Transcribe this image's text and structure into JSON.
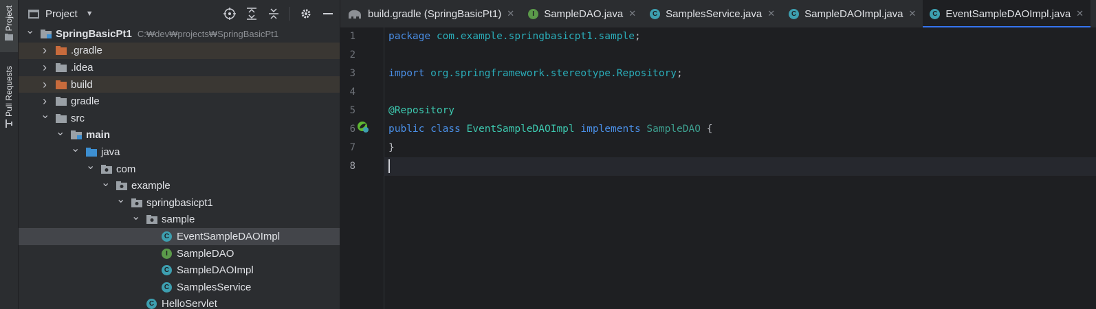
{
  "sidebar": {
    "project_tab": "Project",
    "pull_requests_tab": "Pull Requests"
  },
  "project_panel": {
    "title": "Project",
    "tree": [
      {
        "label": "SpringBasicPt1",
        "path": "C:₩dev₩projects₩SpringBasicPt1",
        "depth": 0,
        "expanded": true,
        "icon": "module-folder-icon",
        "bold": true
      },
      {
        "label": ".gradle",
        "depth": 1,
        "expanded": false,
        "icon": "excluded-folder-icon",
        "excluded": true
      },
      {
        "label": ".idea",
        "depth": 1,
        "expanded": false,
        "icon": "folder-icon"
      },
      {
        "label": "build",
        "depth": 1,
        "expanded": false,
        "icon": "excluded-folder-icon",
        "excluded": true
      },
      {
        "label": "gradle",
        "depth": 1,
        "expanded": false,
        "icon": "folder-icon"
      },
      {
        "label": "src",
        "depth": 1,
        "expanded": true,
        "icon": "folder-icon"
      },
      {
        "label": "main",
        "depth": 2,
        "expanded": true,
        "icon": "module-folder-icon",
        "bold": true
      },
      {
        "label": "java",
        "depth": 3,
        "expanded": true,
        "icon": "source-folder-icon"
      },
      {
        "label": "com",
        "depth": 4,
        "expanded": true,
        "icon": "package-icon"
      },
      {
        "label": "example",
        "depth": 5,
        "expanded": true,
        "icon": "package-icon"
      },
      {
        "label": "springbasicpt1",
        "depth": 6,
        "expanded": true,
        "icon": "package-icon"
      },
      {
        "label": "sample",
        "depth": 7,
        "expanded": true,
        "icon": "package-icon"
      },
      {
        "label": "EventSampleDAOImpl",
        "depth": 8,
        "icon": "class-icon",
        "selected": true
      },
      {
        "label": "SampleDAO",
        "depth": 8,
        "icon": "interface-icon"
      },
      {
        "label": "SampleDAOImpl",
        "depth": 8,
        "icon": "class-icon"
      },
      {
        "label": "SamplesService",
        "depth": 8,
        "icon": "class-icon"
      },
      {
        "label": "HelloServlet",
        "depth": 7,
        "icon": "class-icon"
      }
    ]
  },
  "tabs": [
    {
      "label": "build.gradle (SpringBasicPt1)",
      "icon": "gradle-elephant-icon",
      "active": false
    },
    {
      "label": "SampleDAO.java",
      "icon": "interface-icon",
      "active": false
    },
    {
      "label": "SamplesService.java",
      "icon": "class-icon",
      "active": false
    },
    {
      "label": "SampleDAOImpl.java",
      "icon": "class-icon",
      "active": false
    },
    {
      "label": "EventSampleDAOImpl.java",
      "icon": "class-icon",
      "active": true
    }
  ],
  "editor": {
    "current_line": 8,
    "lines": [
      {
        "n": "1",
        "tokens": [
          [
            "kw blue",
            "package "
          ],
          [
            "pkg",
            "com.example.springbasicpt1.sample"
          ],
          [
            "",
            "; "
          ]
        ]
      },
      {
        "n": "2",
        "tokens": []
      },
      {
        "n": "3",
        "tokens": [
          [
            "kw blue",
            "import "
          ],
          [
            "pkg",
            "org.springframework.stereotype.Repository"
          ],
          [
            "",
            ";"
          ]
        ]
      },
      {
        "n": "4",
        "tokens": []
      },
      {
        "n": "5",
        "tokens": [
          [
            "ann",
            "@Repository"
          ]
        ]
      },
      {
        "n": "6",
        "tokens": [
          [
            "kw blue",
            "public class "
          ],
          [
            "cls",
            "EventSampleDAOImpl "
          ],
          [
            "kw blue",
            "implements "
          ],
          [
            "iface",
            "SampleDAO "
          ],
          [
            "",
            "{"
          ]
        ]
      },
      {
        "n": "7",
        "tokens": [
          [
            "",
            "}"
          ]
        ]
      },
      {
        "n": "8",
        "tokens": []
      }
    ]
  },
  "colors": {
    "accent": "#3574f0",
    "excluded_folder": "#c86b3c",
    "class_icon": "#3d9fb0",
    "interface_icon": "#5b9a4a"
  }
}
